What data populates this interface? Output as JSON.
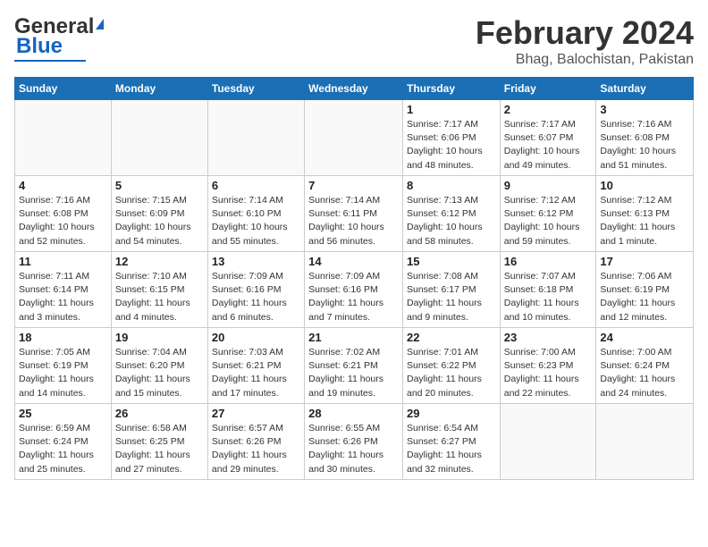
{
  "header": {
    "logo_general": "General",
    "logo_blue": "Blue",
    "month": "February 2024",
    "location": "Bhag, Balochistan, Pakistan"
  },
  "days_of_week": [
    "Sunday",
    "Monday",
    "Tuesday",
    "Wednesday",
    "Thursday",
    "Friday",
    "Saturday"
  ],
  "weeks": [
    [
      {
        "day": "",
        "info": ""
      },
      {
        "day": "",
        "info": ""
      },
      {
        "day": "",
        "info": ""
      },
      {
        "day": "",
        "info": ""
      },
      {
        "day": "1",
        "info": "Sunrise: 7:17 AM\nSunset: 6:06 PM\nDaylight: 10 hours\nand 48 minutes."
      },
      {
        "day": "2",
        "info": "Sunrise: 7:17 AM\nSunset: 6:07 PM\nDaylight: 10 hours\nand 49 minutes."
      },
      {
        "day": "3",
        "info": "Sunrise: 7:16 AM\nSunset: 6:08 PM\nDaylight: 10 hours\nand 51 minutes."
      }
    ],
    [
      {
        "day": "4",
        "info": "Sunrise: 7:16 AM\nSunset: 6:08 PM\nDaylight: 10 hours\nand 52 minutes."
      },
      {
        "day": "5",
        "info": "Sunrise: 7:15 AM\nSunset: 6:09 PM\nDaylight: 10 hours\nand 54 minutes."
      },
      {
        "day": "6",
        "info": "Sunrise: 7:14 AM\nSunset: 6:10 PM\nDaylight: 10 hours\nand 55 minutes."
      },
      {
        "day": "7",
        "info": "Sunrise: 7:14 AM\nSunset: 6:11 PM\nDaylight: 10 hours\nand 56 minutes."
      },
      {
        "day": "8",
        "info": "Sunrise: 7:13 AM\nSunset: 6:12 PM\nDaylight: 10 hours\nand 58 minutes."
      },
      {
        "day": "9",
        "info": "Sunrise: 7:12 AM\nSunset: 6:12 PM\nDaylight: 10 hours\nand 59 minutes."
      },
      {
        "day": "10",
        "info": "Sunrise: 7:12 AM\nSunset: 6:13 PM\nDaylight: 11 hours\nand 1 minute."
      }
    ],
    [
      {
        "day": "11",
        "info": "Sunrise: 7:11 AM\nSunset: 6:14 PM\nDaylight: 11 hours\nand 3 minutes."
      },
      {
        "day": "12",
        "info": "Sunrise: 7:10 AM\nSunset: 6:15 PM\nDaylight: 11 hours\nand 4 minutes."
      },
      {
        "day": "13",
        "info": "Sunrise: 7:09 AM\nSunset: 6:16 PM\nDaylight: 11 hours\nand 6 minutes."
      },
      {
        "day": "14",
        "info": "Sunrise: 7:09 AM\nSunset: 6:16 PM\nDaylight: 11 hours\nand 7 minutes."
      },
      {
        "day": "15",
        "info": "Sunrise: 7:08 AM\nSunset: 6:17 PM\nDaylight: 11 hours\nand 9 minutes."
      },
      {
        "day": "16",
        "info": "Sunrise: 7:07 AM\nSunset: 6:18 PM\nDaylight: 11 hours\nand 10 minutes."
      },
      {
        "day": "17",
        "info": "Sunrise: 7:06 AM\nSunset: 6:19 PM\nDaylight: 11 hours\nand 12 minutes."
      }
    ],
    [
      {
        "day": "18",
        "info": "Sunrise: 7:05 AM\nSunset: 6:19 PM\nDaylight: 11 hours\nand 14 minutes."
      },
      {
        "day": "19",
        "info": "Sunrise: 7:04 AM\nSunset: 6:20 PM\nDaylight: 11 hours\nand 15 minutes."
      },
      {
        "day": "20",
        "info": "Sunrise: 7:03 AM\nSunset: 6:21 PM\nDaylight: 11 hours\nand 17 minutes."
      },
      {
        "day": "21",
        "info": "Sunrise: 7:02 AM\nSunset: 6:21 PM\nDaylight: 11 hours\nand 19 minutes."
      },
      {
        "day": "22",
        "info": "Sunrise: 7:01 AM\nSunset: 6:22 PM\nDaylight: 11 hours\nand 20 minutes."
      },
      {
        "day": "23",
        "info": "Sunrise: 7:00 AM\nSunset: 6:23 PM\nDaylight: 11 hours\nand 22 minutes."
      },
      {
        "day": "24",
        "info": "Sunrise: 7:00 AM\nSunset: 6:24 PM\nDaylight: 11 hours\nand 24 minutes."
      }
    ],
    [
      {
        "day": "25",
        "info": "Sunrise: 6:59 AM\nSunset: 6:24 PM\nDaylight: 11 hours\nand 25 minutes."
      },
      {
        "day": "26",
        "info": "Sunrise: 6:58 AM\nSunset: 6:25 PM\nDaylight: 11 hours\nand 27 minutes."
      },
      {
        "day": "27",
        "info": "Sunrise: 6:57 AM\nSunset: 6:26 PM\nDaylight: 11 hours\nand 29 minutes."
      },
      {
        "day": "28",
        "info": "Sunrise: 6:55 AM\nSunset: 6:26 PM\nDaylight: 11 hours\nand 30 minutes."
      },
      {
        "day": "29",
        "info": "Sunrise: 6:54 AM\nSunset: 6:27 PM\nDaylight: 11 hours\nand 32 minutes."
      },
      {
        "day": "",
        "info": ""
      },
      {
        "day": "",
        "info": ""
      }
    ]
  ]
}
